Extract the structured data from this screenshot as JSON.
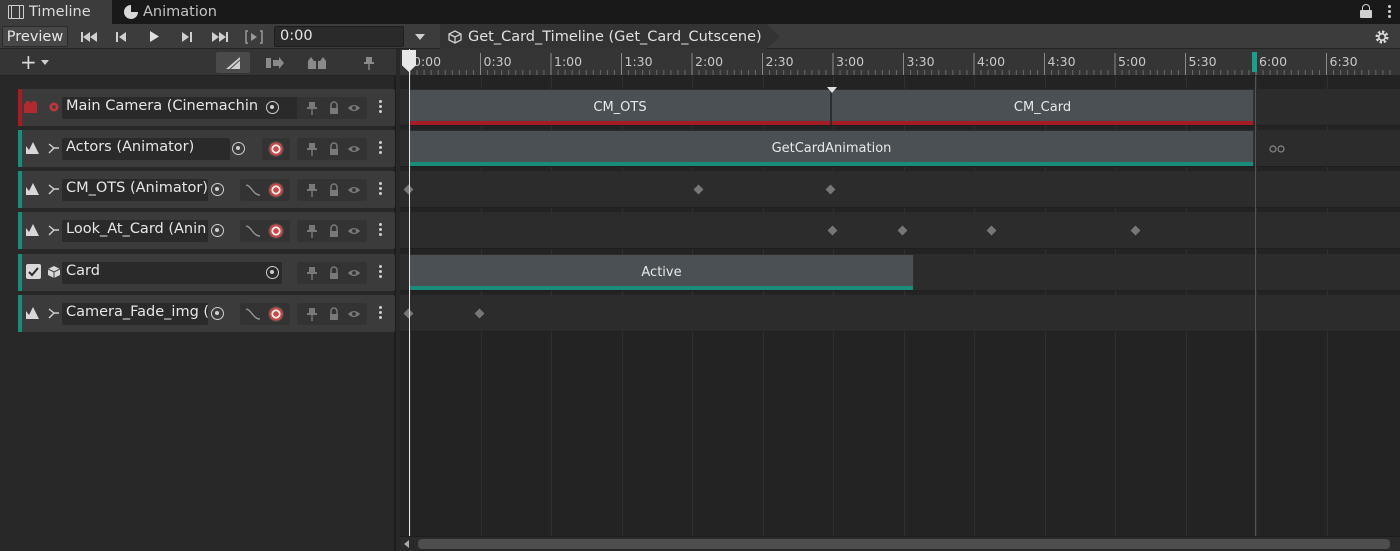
{
  "window_tabs": [
    {
      "label": "Timeline",
      "icon": "film-icon"
    },
    {
      "label": "Animation",
      "icon": "animation-icon"
    }
  ],
  "toolbar": {
    "preview_label": "Preview",
    "time_value": "0:00",
    "breadcrumb": "Get_Card_Timeline (Get_Card_Cutscene)"
  },
  "ruler": {
    "ticks": [
      "0:00",
      "0:30",
      "1:00",
      "1:30",
      "2:00",
      "2:30",
      "3:00",
      "3:30",
      "4:00",
      "4:30",
      "5:00",
      "5:30",
      "6:00",
      "6:30"
    ]
  },
  "tracks": [
    {
      "name": "Main Camera (Cinemachin",
      "kind": "cinemachine",
      "color": "#a51c24"
    },
    {
      "name": "Actors (Animator)",
      "kind": "animation",
      "color": "#1a8c7c"
    },
    {
      "name": "CM_OTS (Animator)",
      "kind": "animation",
      "color": "#1a8c7c"
    },
    {
      "name": "Look_At_Card (Anin",
      "kind": "animation",
      "color": "#1a8c7c"
    },
    {
      "name": "Card",
      "kind": "activation",
      "color": "#1a8c7c"
    },
    {
      "name": "Camera_Fade_img (",
      "kind": "animation",
      "color": "#1a8c7c"
    }
  ],
  "clips": {
    "cm_ots": "CM_OTS",
    "cm_card": "CM_Card",
    "get_card_animation": "GetCardAnimation",
    "active": "Active"
  },
  "colors": {
    "cinemachine_accent": "#a51c24",
    "animation_accent": "#1a8c7c",
    "playhead": "#e8e8e8"
  }
}
